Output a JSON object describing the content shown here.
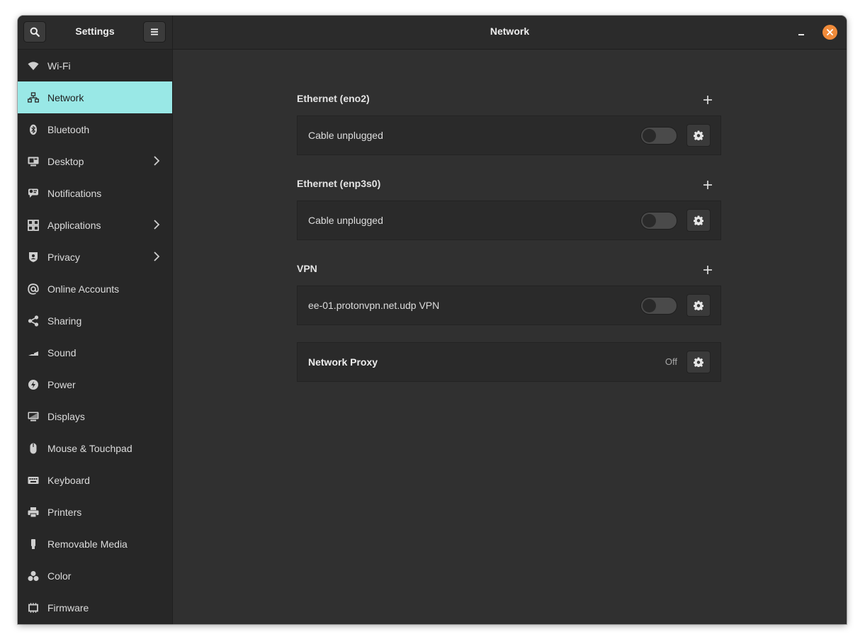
{
  "header": {
    "app_title": "Settings",
    "page_title": "Network"
  },
  "sidebar": {
    "items": [
      {
        "label": "Wi-Fi",
        "icon": "wifi-icon",
        "chevron": false,
        "active": false
      },
      {
        "label": "Network",
        "icon": "network-icon",
        "chevron": false,
        "active": true
      },
      {
        "label": "Bluetooth",
        "icon": "bluetooth-icon",
        "chevron": false,
        "active": false
      },
      {
        "label": "Desktop",
        "icon": "desktop-icon",
        "chevron": true,
        "active": false
      },
      {
        "label": "Notifications",
        "icon": "notifications-icon",
        "chevron": false,
        "active": false
      },
      {
        "label": "Applications",
        "icon": "applications-icon",
        "chevron": true,
        "active": false
      },
      {
        "label": "Privacy",
        "icon": "privacy-icon",
        "chevron": true,
        "active": false
      },
      {
        "label": "Online Accounts",
        "icon": "online-accounts-icon",
        "chevron": false,
        "active": false
      },
      {
        "label": "Sharing",
        "icon": "sharing-icon",
        "chevron": false,
        "active": false
      },
      {
        "label": "Sound",
        "icon": "sound-icon",
        "chevron": false,
        "active": false
      },
      {
        "label": "Power",
        "icon": "power-icon",
        "chevron": false,
        "active": false
      },
      {
        "label": "Displays",
        "icon": "displays-icon",
        "chevron": false,
        "active": false
      },
      {
        "label": "Mouse & Touchpad",
        "icon": "mouse-icon",
        "chevron": false,
        "active": false
      },
      {
        "label": "Keyboard",
        "icon": "keyboard-icon",
        "chevron": false,
        "active": false
      },
      {
        "label": "Printers",
        "icon": "printer-icon",
        "chevron": false,
        "active": false
      },
      {
        "label": "Removable Media",
        "icon": "removable-media-icon",
        "chevron": false,
        "active": false
      },
      {
        "label": "Color",
        "icon": "color-icon",
        "chevron": false,
        "active": false
      },
      {
        "label": "Firmware",
        "icon": "firmware-icon",
        "chevron": false,
        "active": false
      }
    ]
  },
  "main": {
    "sections": [
      {
        "title": "Ethernet (eno2)",
        "row_label": "Cable unplugged",
        "toggle_on": false
      },
      {
        "title": "Ethernet (enp3s0)",
        "row_label": "Cable unplugged",
        "toggle_on": false
      },
      {
        "title": "VPN",
        "row_label": "ee-01.protonvpn.net.udp VPN",
        "toggle_on": false
      }
    ],
    "proxy": {
      "label": "Network Proxy",
      "status": "Off"
    }
  },
  "colors": {
    "accent": "#99e8e6",
    "close_button": "#f08b3a",
    "window_bg": "#303030",
    "sidebar_bg": "#272727"
  }
}
